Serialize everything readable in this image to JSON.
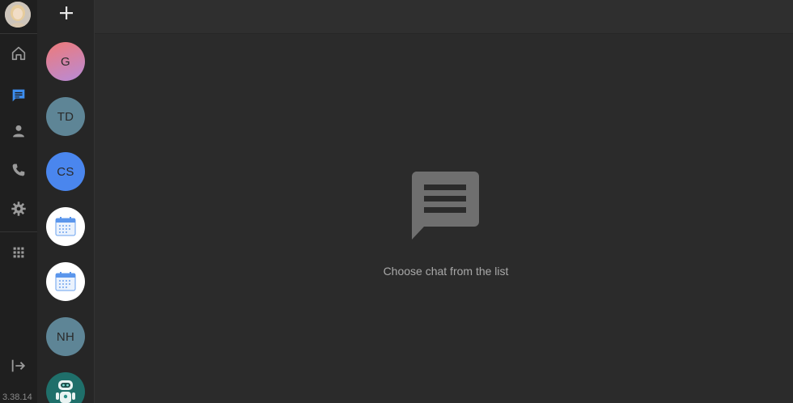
{
  "app": {
    "version": "3.38.14",
    "accent_color": "#3d8ef0"
  },
  "nav": {
    "items": [
      {
        "id": "home",
        "icon": "home-icon",
        "active": false
      },
      {
        "id": "chats",
        "icon": "chat-icon",
        "active": true
      },
      {
        "id": "contacts",
        "icon": "person-icon",
        "active": false
      },
      {
        "id": "calls",
        "icon": "phone-icon",
        "active": false
      },
      {
        "id": "settings",
        "icon": "gear-icon",
        "active": false
      },
      {
        "id": "apps",
        "icon": "apps-grid-icon",
        "active": false
      }
    ],
    "logout_icon": "logout-icon"
  },
  "chats": [
    {
      "initials": "G",
      "kind": "initials",
      "color": "#e07a82"
    },
    {
      "initials": "TD",
      "kind": "initials",
      "color": "#5e8596"
    },
    {
      "initials": "CS",
      "kind": "initials",
      "color": "#4a86ee"
    },
    {
      "initials": "",
      "kind": "calendar",
      "icon": "calendar-icon"
    },
    {
      "initials": "",
      "kind": "calendar",
      "icon": "calendar-icon"
    },
    {
      "initials": "NH",
      "kind": "initials",
      "color": "#5e8596"
    },
    {
      "initials": "",
      "kind": "bot",
      "icon": "robot-icon"
    }
  ],
  "main": {
    "empty_message": "Choose chat from the list",
    "empty_icon": "chat-bubble-icon"
  }
}
